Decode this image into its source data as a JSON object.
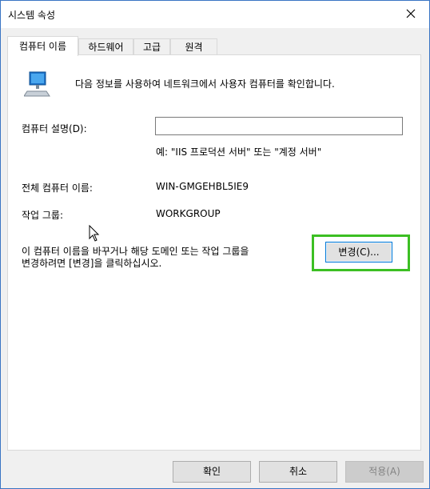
{
  "window": {
    "title": "시스템 속성"
  },
  "tabs": [
    {
      "label": "컴퓨터 이름"
    },
    {
      "label": "하드웨어"
    },
    {
      "label": "고급"
    },
    {
      "label": "원격"
    }
  ],
  "computer_name_tab": {
    "info_text": "다음 정보를 사용하여 네트워크에서 사용자 컴퓨터를 확인합니다.",
    "description_label": "컴퓨터 설명(D):",
    "description_value": "",
    "description_example": "예: \"IIS 프로덕션 서버\" 또는 \"계정 서버\"",
    "full_name_label": "전체 컴퓨터 이름:",
    "full_name_value": "WIN-GMGEHBL5IE9",
    "workgroup_label": "작업 그룹:",
    "workgroup_value": "WORKGROUP",
    "rename_text_line1": "이 컴퓨터 이름을 바꾸거나 해당 도메인 또는 작업 그룹을",
    "rename_text_line2": "변경하려면 [변경]을 클릭하십시오.",
    "change_button": "변경(C)..."
  },
  "footer": {
    "ok": "확인",
    "cancel": "취소",
    "apply": "적용(A)"
  },
  "icons": {
    "close": "close-icon",
    "computer": "computer-icon",
    "cursor": "mouse-pointer-icon"
  },
  "colors": {
    "highlight": "#3cbf23",
    "window_border": "#3a75c4",
    "button_focus": "#0078d7"
  }
}
